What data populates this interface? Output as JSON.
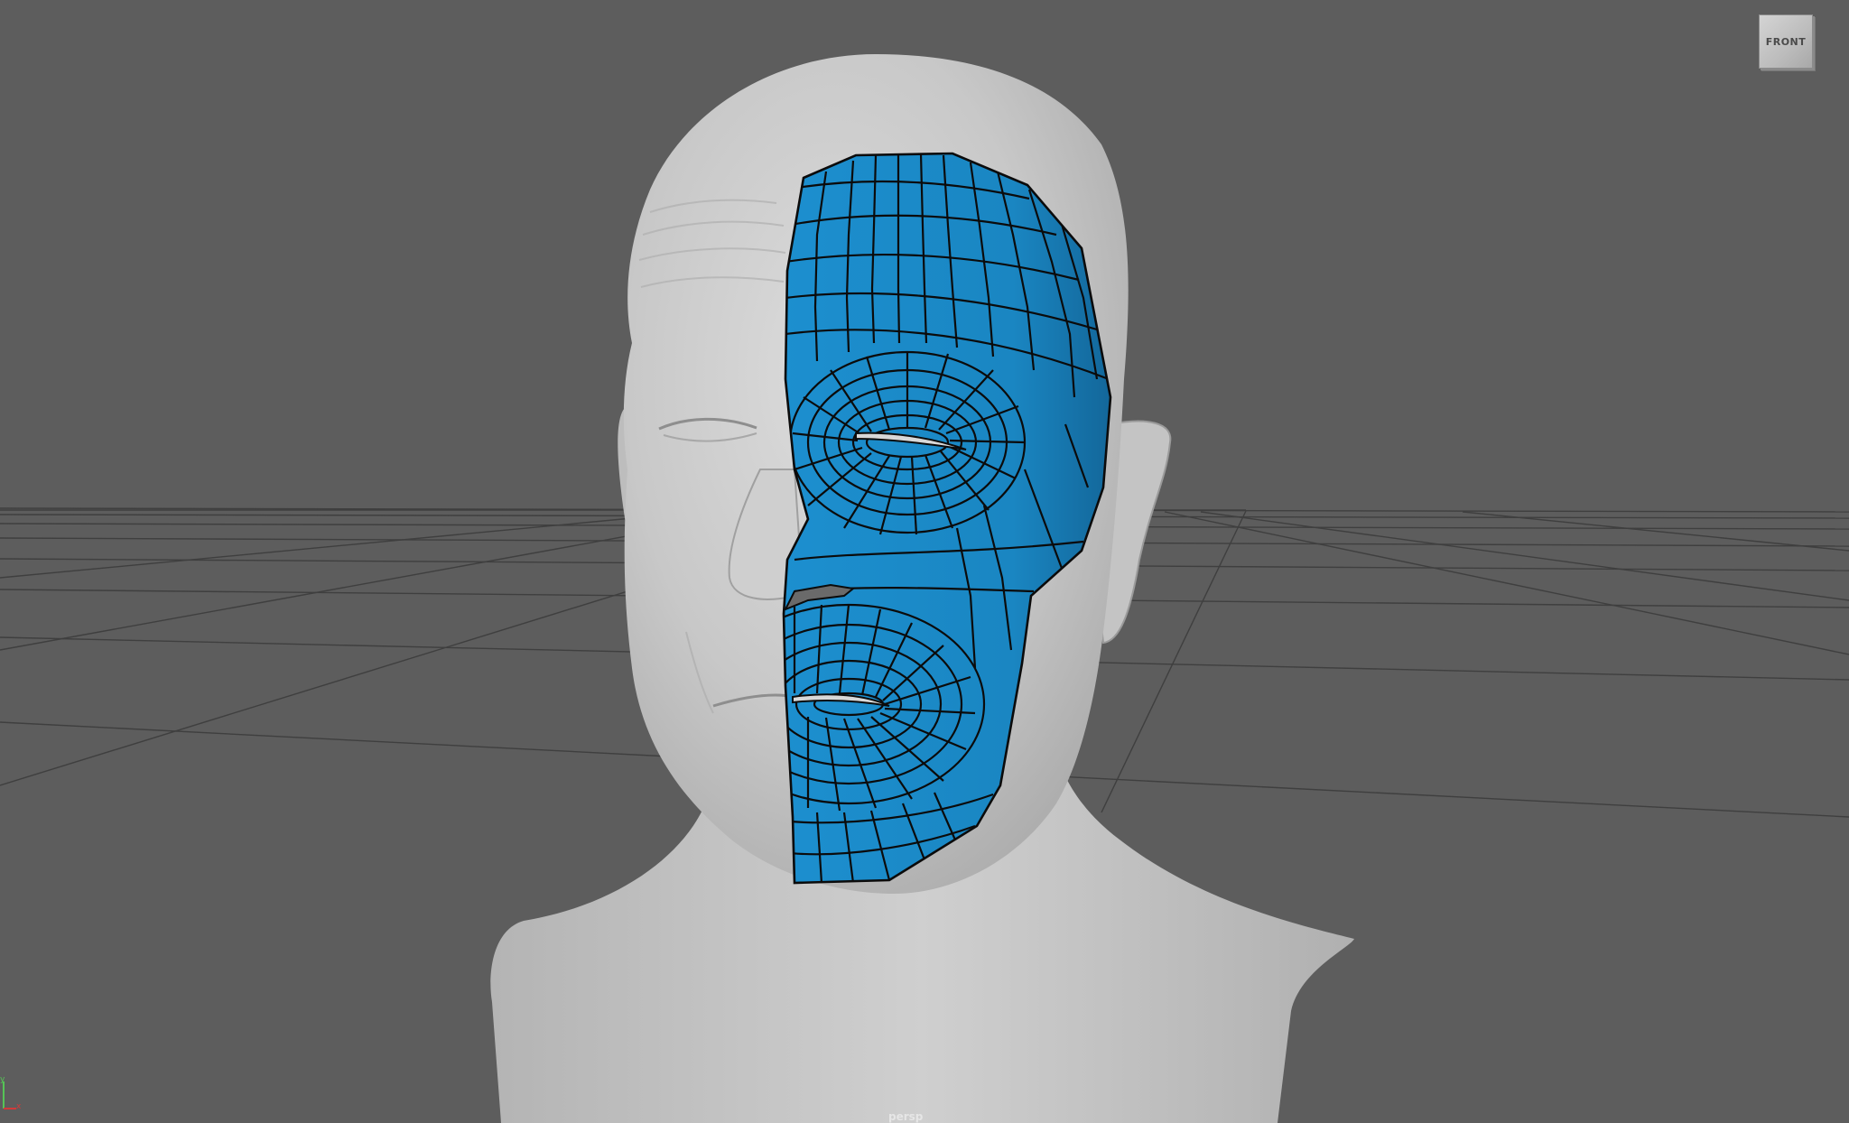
{
  "viewport": {
    "background_color": "#5d5d5d",
    "grid_color": "#3f3f3f",
    "camera_name": "persp",
    "view_cube_label": "FRONT"
  },
  "model": {
    "sculpt_color": "#c9c9c9",
    "retopo_color": "#1a87c4",
    "wire_color": "#0b0b0b"
  },
  "axis_gizmo": {
    "x_color": "#d23a3a",
    "y_color": "#56c456"
  }
}
